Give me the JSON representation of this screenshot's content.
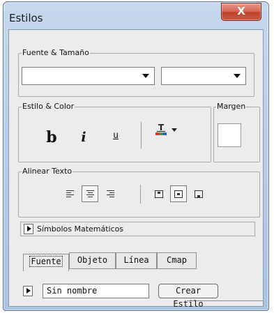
{
  "window": {
    "title": "Estilos",
    "close_glyph": "X"
  },
  "fuente_tamano": {
    "label": "Fuente & Tamaño",
    "font_value": "",
    "size_value": ""
  },
  "estilo_color": {
    "label": "Estilo & Color",
    "bold": "b",
    "italic": "i",
    "underline": "u",
    "color_glyph": "T"
  },
  "margen": {
    "label": "Margen"
  },
  "alinear": {
    "label": "Alinear Texto"
  },
  "simbolos": {
    "label": "Símbolos Matemáticos"
  },
  "tabs": [
    {
      "label": "Fuente"
    },
    {
      "label": "Objeto"
    },
    {
      "label": "Línea"
    },
    {
      "label": "Cmap"
    }
  ],
  "style_name": {
    "value": "Sin nombre"
  },
  "crear_estilo": {
    "label": "Crear Estilo"
  },
  "colors": {
    "accent_close": "#c0412c",
    "frame": "#b9cfe8",
    "panel": "#ececec"
  }
}
